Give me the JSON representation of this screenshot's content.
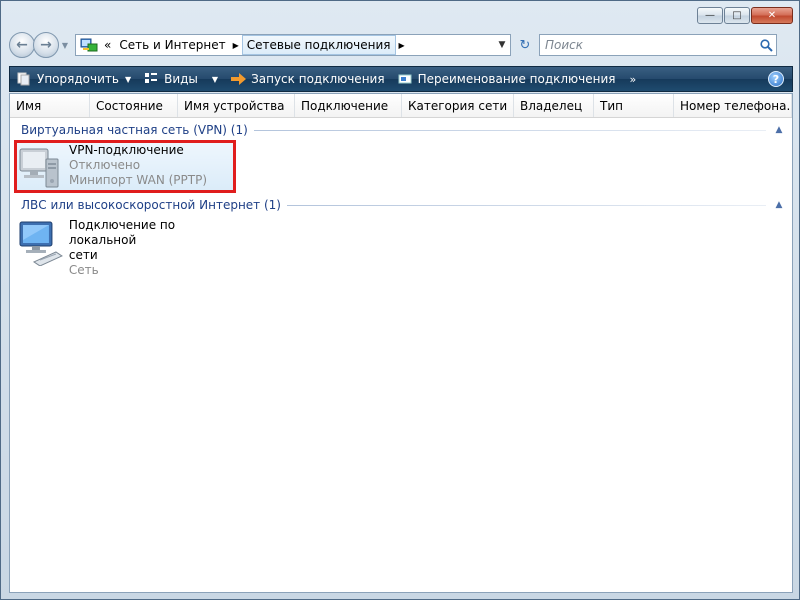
{
  "window": {
    "caption_buttons": {
      "minimize": "—",
      "maximize": "□",
      "close": "✕"
    }
  },
  "address": {
    "overflow": "«",
    "segments": [
      "Сеть и Интернет",
      "Сетевые подключения"
    ],
    "search_placeholder": "Поиск"
  },
  "toolbar": {
    "organize": "Упорядочить",
    "views": "Виды",
    "start_connection": "Запуск подключения",
    "rename_connection": "Переименование подключения",
    "more": "»",
    "help": "?"
  },
  "columns": [
    "Имя",
    "Состояние",
    "Имя устройства",
    "Подключение",
    "Категория сети",
    "Владелец",
    "Тип",
    "Номер телефона..."
  ],
  "groups": [
    {
      "title": "Виртуальная частная сеть (VPN) (1)",
      "items": [
        {
          "name": "VPN-подключение",
          "status": "Отключено",
          "device": "Минипорт WAN (PPTP)"
        }
      ]
    },
    {
      "title": "ЛВС или высокоскоростной Интернет (1)",
      "items": [
        {
          "name_line1": "Подключение по локальной",
          "name_line2": "сети",
          "category": "Сеть"
        }
      ]
    }
  ],
  "colors": {
    "group_title": "#1e3f86",
    "highlight_border": "#e01d1d",
    "toolbar_bg": "#254a6d"
  }
}
